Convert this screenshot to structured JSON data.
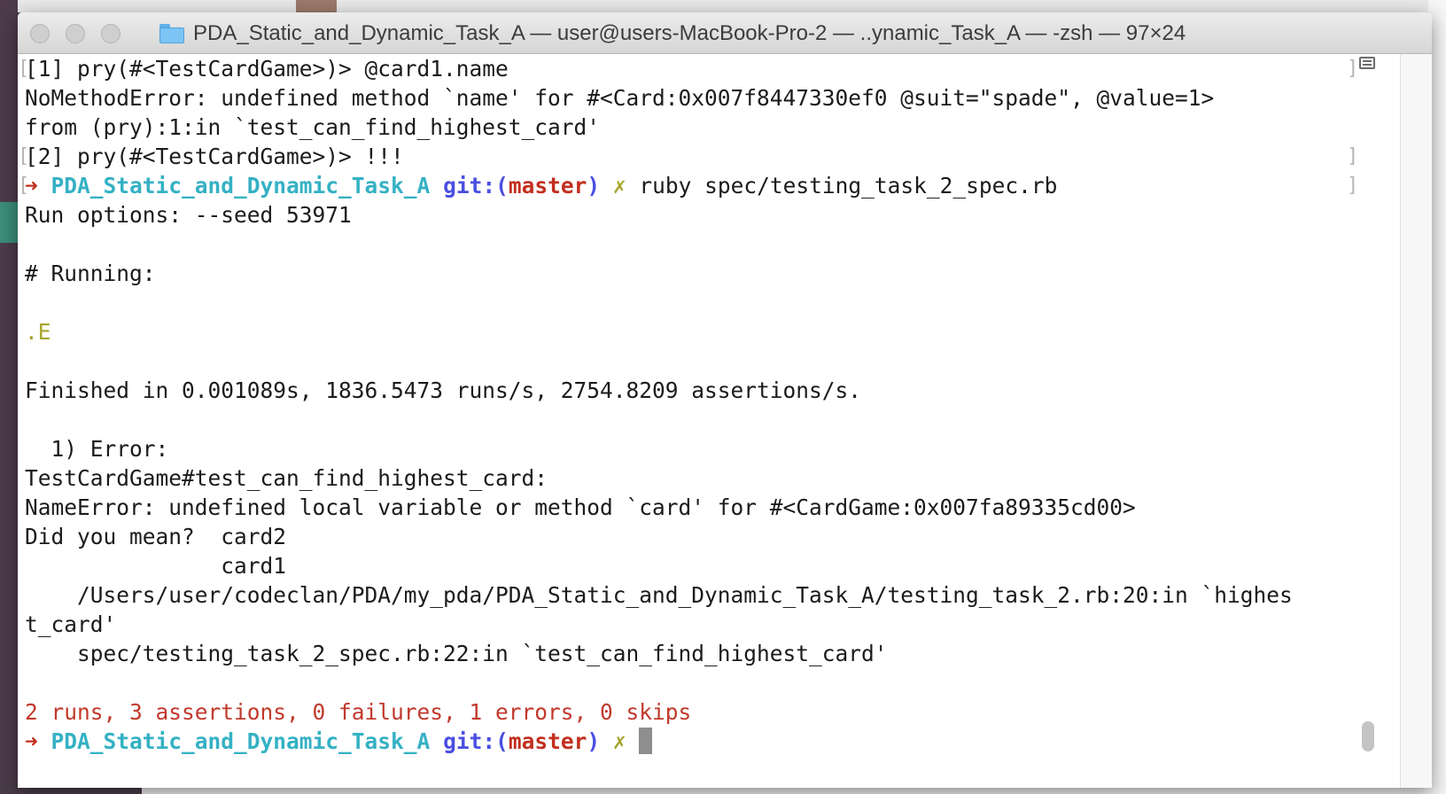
{
  "window": {
    "title": "PDA_Static_and_Dynamic_Task_A — user@users-MacBook-Pro-2 — ..ynamic_Task_A — -zsh — 97×24"
  },
  "terminal": {
    "lines": {
      "l1": "[1] pry(#<TestCardGame>)> @card1.name",
      "l2": "NoMethodError: undefined method `name' for #<Card:0x007f8447330ef0 @suit=\"spade\", @value=1>",
      "l3": "from (pry):1:in `test_can_find_highest_card'",
      "l4": "[2] pry(#<TestCardGame>)> !!!",
      "l6": "Run options: --seed 53971",
      "l8": "# Running:",
      "l10_dot": ".",
      "l10_e": "E",
      "l12": "Finished in 0.001089s, 1836.5473 runs/s, 2754.8209 assertions/s.",
      "l14": "  1) Error:",
      "l15": "TestCardGame#test_can_find_highest_card:",
      "l16": "NameError: undefined local variable or method `card' for #<CardGame:0x007fa89335cd00>",
      "l17": "Did you mean?  card2",
      "l18": "               card1",
      "l19": "    /Users/user/codeclan/PDA/my_pda/PDA_Static_and_Dynamic_Task_A/testing_task_2.rb:20:in `highes",
      "l20": "t_card'",
      "l21": "    spec/testing_task_2_spec.rb:22:in `test_can_find_highest_card'",
      "l23": "2 runs, 3 assertions, 0 failures, 1 errors, 0 skips"
    },
    "prompt": {
      "arrow": "➜",
      "dir": "PDA_Static_and_Dynamic_Task_A",
      "git_label": "git:(",
      "branch": "master",
      "git_close": ")",
      "dirty": "✗",
      "command": "ruby spec/testing_task_2_spec.rb"
    },
    "brackets": {
      "open": "[",
      "close": "]"
    },
    "colors": {
      "arrow": "#c22f1f",
      "dir": "#35b1c4",
      "git": "#4a4fe0",
      "branch": "#c22f1f",
      "dirty": "#a6a52a",
      "summary": "#c1392b"
    }
  }
}
